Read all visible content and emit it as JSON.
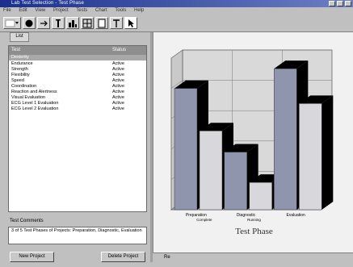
{
  "window": {
    "title": "Lab Test Selection - Test Phase"
  },
  "menu": [
    "File",
    "Edit",
    "View",
    "Project",
    "Tests",
    "Chart",
    "Tools",
    "Help"
  ],
  "toolbar": {
    "icons": [
      "dropdown-icon",
      "record-icon",
      "arrow-icon",
      "cursor-icon",
      "bar-chart-icon",
      "grid-icon",
      "page-icon",
      "text-icon",
      "pointer-icon"
    ]
  },
  "panel_tab": "List",
  "list": {
    "headers": [
      "Test",
      "Status"
    ],
    "rows": [
      {
        "name": "Dexterity",
        "status": "",
        "selected": true
      },
      {
        "name": "Endurance",
        "status": "Active"
      },
      {
        "name": "Strength",
        "status": "Active"
      },
      {
        "name": "Flexibility",
        "status": "Active"
      },
      {
        "name": "Speed",
        "status": "Active"
      },
      {
        "name": "Coordination",
        "status": "Active"
      },
      {
        "name": "Reaction and Alertness",
        "status": "Active"
      },
      {
        "name": "Visual Evaluation",
        "status": "Active"
      },
      {
        "name": "ECG Level 1 Evaluation",
        "status": "Active"
      },
      {
        "name": "ECG Level 2 Evaluation",
        "status": "Active"
      }
    ]
  },
  "comments": {
    "label": "Test Comments",
    "text": "3 of 5 Test Phases of Projects: Preparation, Diagnostic, Evaluation"
  },
  "buttons": {
    "left": "New Project",
    "right": "Delete Project"
  },
  "status_bar": {
    "text": "Re"
  },
  "colors": {
    "bar_a": "#8f95ad",
    "bar_b": "#d8d8dc",
    "bar_shadow": "#000000"
  },
  "chart_data": {
    "type": "bar",
    "title": "Test Phase",
    "categories": [
      "Preparation",
      "Diagnostic",
      "Evaluation"
    ],
    "category_sublabels": [
      "Complete",
      "Running",
      ""
    ],
    "series": [
      {
        "values": [
          80,
          38,
          93
        ]
      },
      {
        "values": [
          52,
          18,
          70
        ]
      }
    ],
    "ylim": [
      0,
      100
    ],
    "grid": true,
    "three_d": true
  }
}
